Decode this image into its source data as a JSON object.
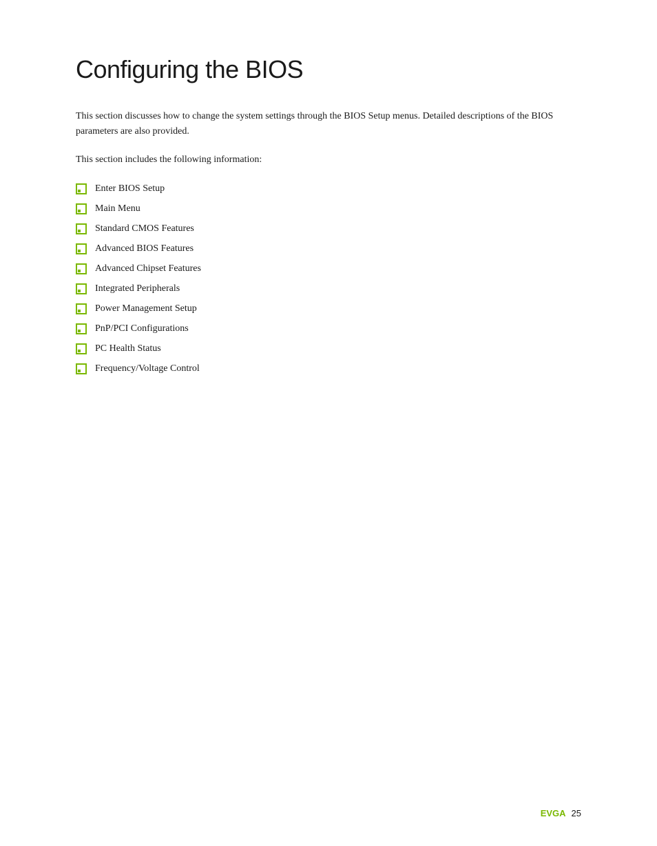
{
  "page": {
    "title": "Configuring the BIOS",
    "intro_paragraph": "This section discusses how to change the system settings through the BIOS Setup menus. Detailed descriptions of the BIOS parameters are also provided.",
    "section_intro": "This section includes the following information:",
    "toc_items": [
      {
        "label": "Enter BIOS Setup"
      },
      {
        "label": "Main Menu"
      },
      {
        "label": "Standard CMOS Features"
      },
      {
        "label": "Advanced BIOS Features"
      },
      {
        "label": "Advanced Chipset Features"
      },
      {
        "label": "Integrated Peripherals"
      },
      {
        "label": "Power Management Setup"
      },
      {
        "label": "PnP/PCI Configurations"
      },
      {
        "label": "PC Health Status"
      },
      {
        "label": "Frequency/Voltage Control"
      }
    ],
    "footer": {
      "brand": "EVGA",
      "page_number": "25"
    }
  }
}
